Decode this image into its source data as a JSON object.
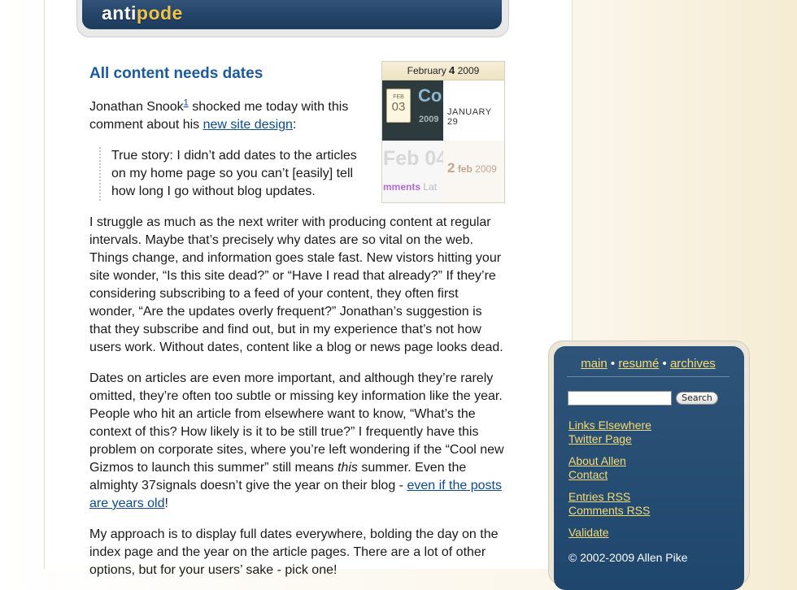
{
  "header": {
    "logo_part1": "anti",
    "logo_part2": "pode"
  },
  "article": {
    "title": "All content needs dates",
    "intro_author": "Jonathan Snook",
    "intro_footnote": "1",
    "intro_mid": " shocked me today with this comment about his ",
    "intro_link": "new site design",
    "intro_end": ":",
    "blockquote": "True story: I didn’t add dates to the articles on my home page so you can’t [easily] tell how long I go without blog updates.",
    "para1": "I struggle as much as the next writer with producing content at regular intervals. Maybe that’s precisely why dates are so vital on the web. Things change, and information goes stale fast. New vistors hitting your site wonder, “Is this site dead?” or “Have I read that already?” If they’re considering subscribing to a feed of your content, they often first wonder, “Are the updates overly frequent?” Jonathan’s suggestion is that they subscribe and find out, but in my experience that’s not how users work. Without dates, content like a blog or news page looks dead.",
    "para2_a": "Dates on articles are even more important, and although they’re rarely omitted, they’re often too subtle or missing key information like the year. People who hit an article from elsewhere want to know, “What’s the context of this? How likely is it to be still true?” I frequently have this problem on corporate sites, where you’re left wondering if the “Cool new Gizmos to launch this summer” still means ",
    "para2_em": "this",
    "para2_b": " summer. Even the almighty 37signals doesn’t give the year on their blog - ",
    "para2_link": "even if the posts are years old",
    "para2_end": "!",
    "para3": "My approach is to display full dates everywhere, bolding the day on the index page and the year on the article pages. There are a lot of other options, but for your users’ sake - pick one!"
  },
  "date_figure": {
    "month": "February",
    "day": "4",
    "year": "2009",
    "panel_a_month": "FEB",
    "panel_a_day": "03",
    "panel_a_title": "Col",
    "panel_a_year": "2009",
    "panel_b_date": "JANUARY 29",
    "panel_c_date": "Feb 04",
    "panel_c_comments": "mments",
    "panel_c_more": "Lat",
    "panel_d_day": "2",
    "panel_d_month": "feb",
    "panel_d_year": "2009"
  },
  "sidebar": {
    "nav_main": "main",
    "nav_resume": "resumé",
    "nav_archives": "archives",
    "nav_sep": " • ",
    "search_value": "",
    "search_button": "Search",
    "links": [
      "Links Elsewhere",
      "Twitter Page",
      "About Allen",
      "Contact",
      "Entries RSS",
      "Comments RSS",
      "Validate"
    ],
    "copyright": "© 2002-2009 Allen Pike"
  },
  "colors": {
    "title": "#1d5a9c",
    "link": "#0d4a8c",
    "sidebar_bg": "#1f466c",
    "sidebar_link": "#f7dc73",
    "logo_accent": "#f0c24a"
  }
}
